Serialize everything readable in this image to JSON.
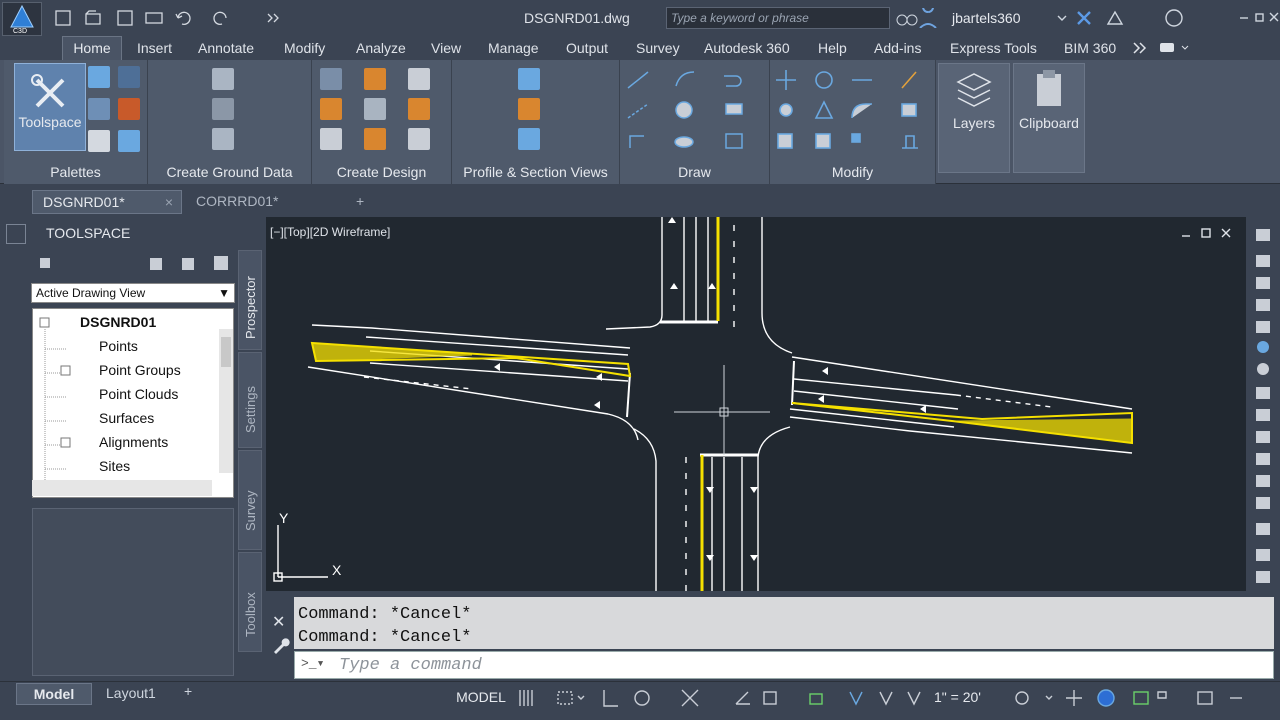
{
  "app": {
    "filename": "DSGNRD01.dwg",
    "logo_text": "C3D",
    "search_placeholder": "Type a keyword or phrase",
    "user": "jbartels360"
  },
  "menus": [
    "Home",
    "Insert",
    "Annotate",
    "Modify",
    "Analyze",
    "View",
    "Manage",
    "Output",
    "Survey",
    "Autodesk 360",
    "Help",
    "Add-ins",
    "Express Tools",
    "BIM 360"
  ],
  "ribbon": {
    "toolspace_label": "Toolspace",
    "panels": [
      "Palettes",
      "Create Ground Data",
      "Create Design",
      "Profile & Section Views",
      "Draw",
      "Modify"
    ],
    "layers_label": "Layers",
    "clipboard_label": "Clipboard"
  },
  "doc_tabs": [
    "DSGNRD01*",
    "CORRRD01*"
  ],
  "toolspace": {
    "title": "TOOLSPACE",
    "view_select": "Active Drawing View",
    "root": "DSGNRD01",
    "items": [
      "Points",
      "Point Groups",
      "Point Clouds",
      "Surfaces",
      "Alignments",
      "Sites"
    ],
    "side_tabs": [
      "Prospector",
      "Settings",
      "Survey",
      "Toolbox"
    ]
  },
  "drawing": {
    "view_label": "[−][Top][2D Wireframe]",
    "ucs_x": "X",
    "ucs_y": "Y"
  },
  "command": {
    "history": [
      "Command: *Cancel*",
      "Command: *Cancel*"
    ],
    "placeholder": "Type a command"
  },
  "status": {
    "model_tab": "Model",
    "layout_tab": "Layout1",
    "space": "MODEL",
    "scale": "1\" = 20'"
  },
  "colors": {
    "accent": "#5f82ad",
    "background": "#212830",
    "linework": "#ffffff",
    "highlight": "#f5e000"
  }
}
